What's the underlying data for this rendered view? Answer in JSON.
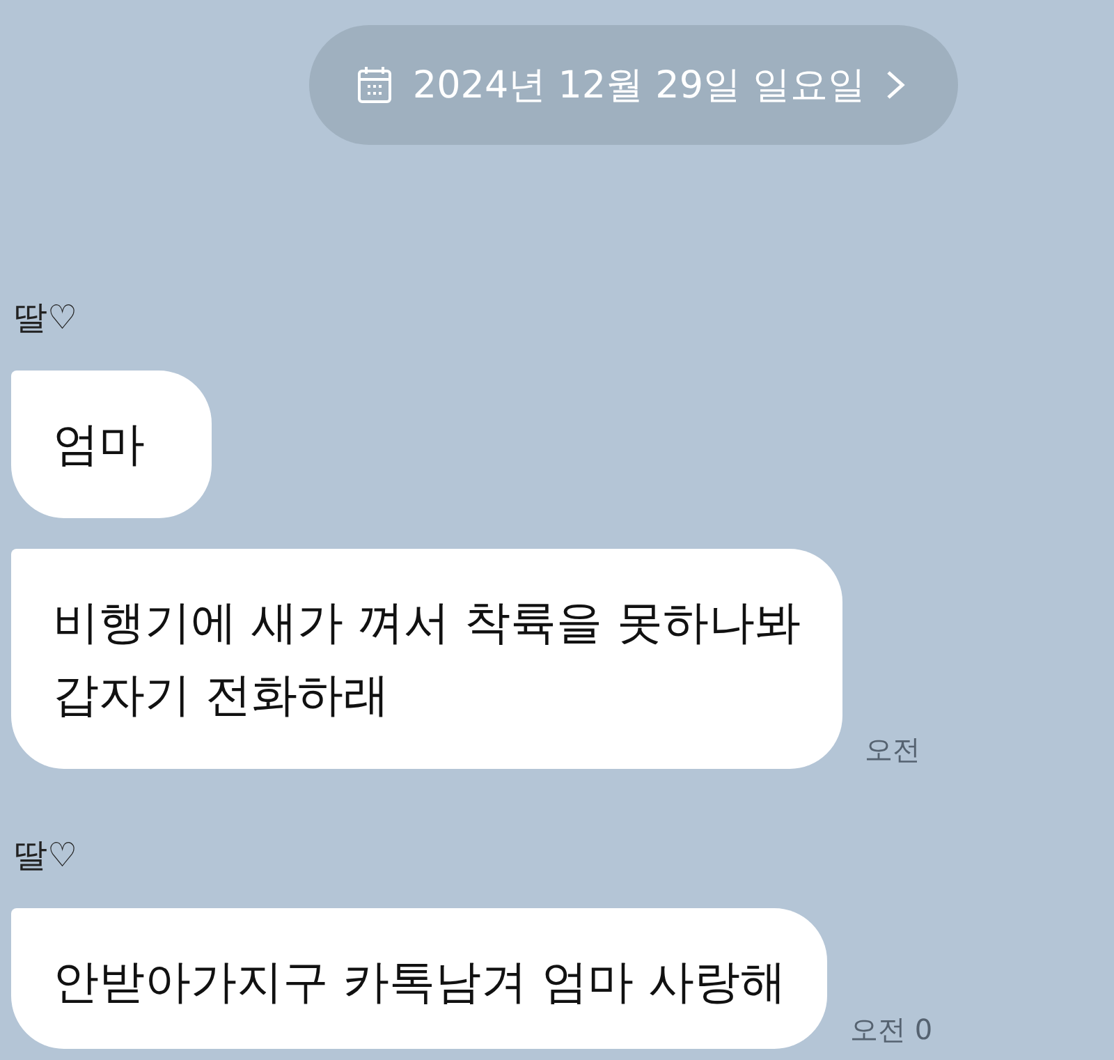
{
  "date_divider": {
    "label": "2024년 12월 29일 일요일"
  },
  "groups": [
    {
      "sender": "딸♡",
      "messages": [
        {
          "text": "엄마"
        },
        {
          "text": "비행기에 새가 껴서 착륙을 못하나봐\n갑자기 전화하래"
        }
      ],
      "time": "오전"
    },
    {
      "sender": "딸♡",
      "messages": [
        {
          "text": "안받아가지구 카톡남겨 엄마 사랑해"
        }
      ],
      "time": "오전 0"
    }
  ]
}
